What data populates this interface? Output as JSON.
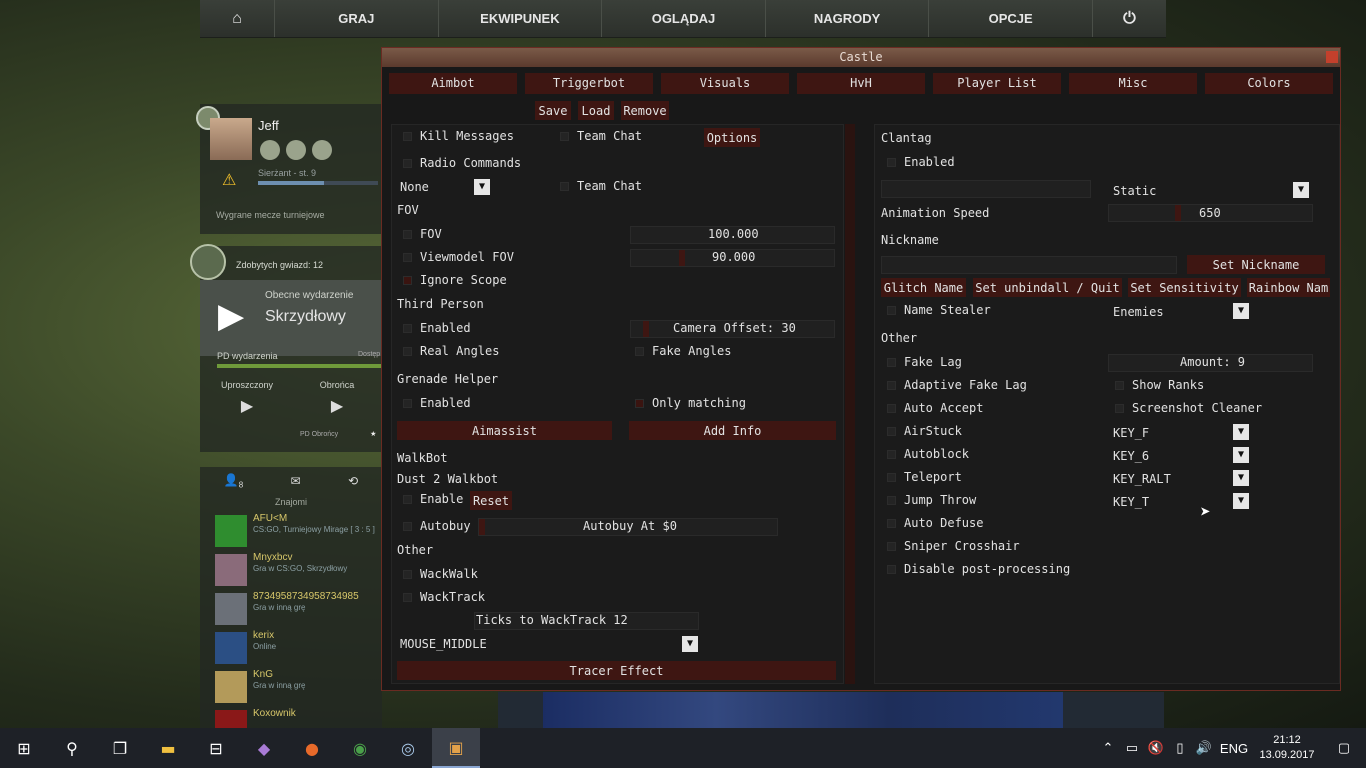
{
  "nav": {
    "home": "⌂",
    "items": [
      "GRAJ",
      "EKWIPUNEK",
      "OGLĄDAJ",
      "NAGRODY",
      "OPCJE"
    ],
    "power": "⏻"
  },
  "profile": {
    "name": "Jeff",
    "rank": "Sierżant - st. 9",
    "wins": "Wygrane mecze turniejowe",
    "xp_fraction": 0.55
  },
  "event": {
    "stars": "Zdobytych gwiazd: 12",
    "current": "Obecne wydarzenie",
    "operation": "Skrzydłowy",
    "pd": "PD wydarzenia",
    "dost": "Dostęp",
    "left_label": "Uproszczony",
    "right_label": "Obrońca",
    "pd_obroncy": "PD Obrońcy",
    "star": "★"
  },
  "friends": {
    "title": "Znajomi",
    "count": "8",
    "list": [
      {
        "name": "AFU<M",
        "status": "CS:GO, Turniejowy Mirage [ 3 : 5 ]",
        "color": "#2f8d2f"
      },
      {
        "name": "Mnyxbcv",
        "status": "Gra w CS:GO, Skrzydłowy",
        "color": "#8a6b7a"
      },
      {
        "name": "8734958734958734985",
        "status": "Gra w inną grę",
        "color": "#6b7078"
      },
      {
        "name": "kerix",
        "status": "Online",
        "color": "#2b4f84"
      },
      {
        "name": "KnG",
        "status": "Gra w inną grę",
        "color": "#b39a5a"
      },
      {
        "name": "Koxownik",
        "status": "",
        "color": "#8a1818"
      }
    ]
  },
  "menu": {
    "title": "Castle",
    "tabs": [
      "Aimbot",
      "Triggerbot",
      "Visuals",
      "HvH",
      "Player List",
      "Misc",
      "Colors"
    ],
    "config": {
      "save": "Save",
      "load": "Load",
      "remove": "Remove"
    },
    "left": {
      "kill_messages": "Kill Messages",
      "team_chat1": "Team Chat",
      "options": "Options",
      "radio_commands": "Radio Commands",
      "none": "None",
      "team_chat2": "Team Chat",
      "fov_section": "FOV",
      "fov": "FOV",
      "fov_value": "100.000",
      "viewmodel_fov": "Viewmodel FOV",
      "viewmodel_value": "90.000",
      "ignore_scope": "Ignore Scope",
      "third_person": "Third Person",
      "tp_enabled": "Enabled",
      "camera_offset": "Camera Offset: 30",
      "real_angles": "Real Angles",
      "fake_angles": "Fake Angles",
      "grenade_helper": "Grenade Helper",
      "gh_enabled": "Enabled",
      "only_matching": "Only matching",
      "aimassist": "Aimassist",
      "add_info": "Add Info",
      "walkbot": "WalkBot",
      "dust2": "Dust 2 Walkbot",
      "enable": "Enable",
      "reset": "Reset",
      "autobuy": "Autobuy",
      "autobuy_at": "Autobuy At $0",
      "other": "Other",
      "wackwalk": "WackWalk",
      "wacktrack": "WackTrack",
      "ticks": "Ticks to WackTrack 12",
      "mouse_middle": "MOUSE_MIDDLE",
      "tracer": "Tracer Effect"
    },
    "right": {
      "clantag": "Clantag",
      "ct_enabled": "Enabled",
      "static": "Static",
      "anim_speed": "Animation Speed",
      "anim_value": "650",
      "nickname": "Nickname",
      "set_nickname": "Set Nickname",
      "glitch_name": "Glitch Name",
      "set_unbind": "Set unbindall / Quit",
      "set_sens": "Set Sensitivity",
      "rainbow": "Rainbow Nam",
      "name_stealer": "Name Stealer",
      "enemies": "Enemies",
      "other": "Other",
      "fake_lag": "Fake Lag",
      "amount": "Amount: 9",
      "adaptive": "Adaptive Fake Lag",
      "show_ranks": "Show Ranks",
      "auto_accept": "Auto Accept",
      "screenshot_cleaner": "Screenshot Cleaner",
      "airstuck": "AirStuck",
      "key_f": "KEY_F",
      "autoblock": "Autoblock",
      "key_6": "KEY_6",
      "teleport": "Teleport",
      "key_ralt": "KEY_RALT",
      "jump_throw": "Jump Throw",
      "key_t": "KEY_T",
      "auto_defuse": "Auto Defuse",
      "sniper_crosshair": "Sniper Crosshair",
      "disable_pp": "Disable post-processing"
    }
  },
  "taskbar": {
    "lang": "ENG",
    "time": "21:12",
    "date": "13.09.2017"
  }
}
